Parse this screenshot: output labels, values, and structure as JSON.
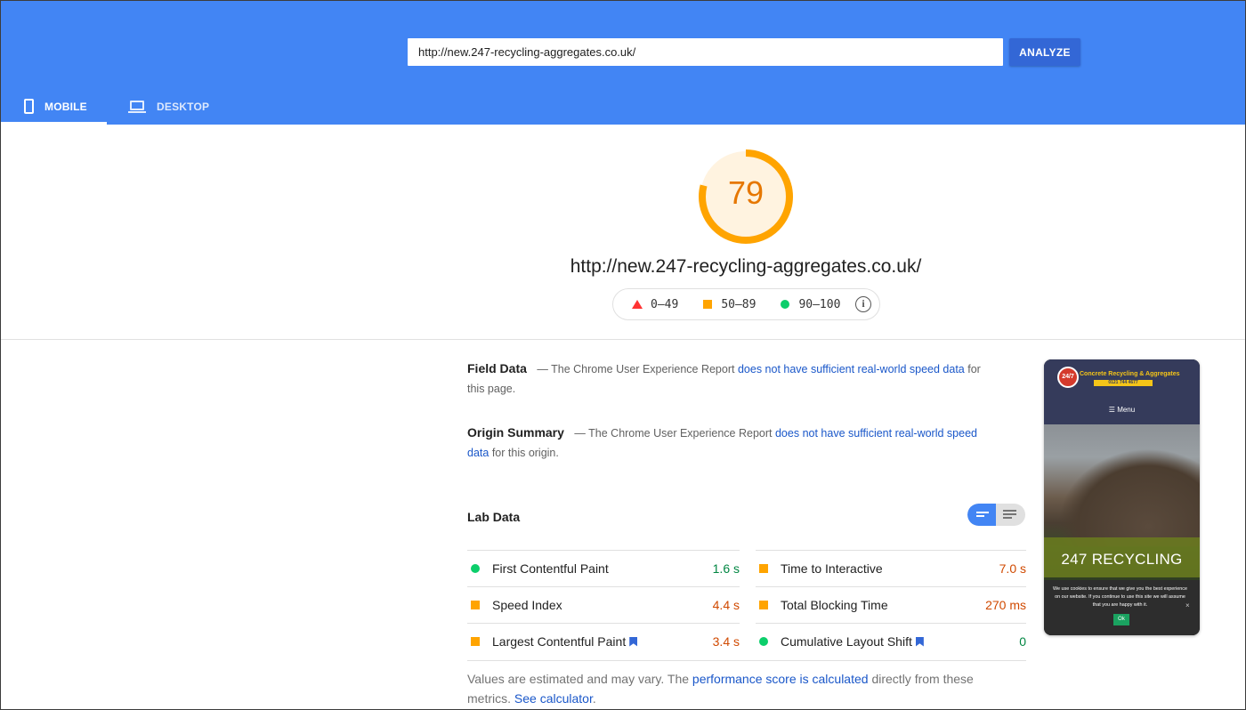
{
  "search": {
    "url_value": "http://new.247-recycling-aggregates.co.uk/",
    "analyze_label": "ANALYZE"
  },
  "tabs": [
    {
      "label": "MOBILE",
      "icon": "phone-icon",
      "active": true
    },
    {
      "label": "DESKTOP",
      "icon": "laptop-icon",
      "active": false
    }
  ],
  "score": {
    "value": "79",
    "fraction": 0.79,
    "color": "#ffa400",
    "page_url": "http://new.247-recycling-aggregates.co.uk/"
  },
  "legend": {
    "fail": "0–49",
    "average": "50–89",
    "pass": "90–100",
    "info_glyph": "i"
  },
  "field_data": {
    "title": "Field Data",
    "prefix": "— The Chrome User Experience Report",
    "link": "does not have sufficient real-world speed data",
    "suffix": "for this page."
  },
  "origin_summary": {
    "title": "Origin Summary",
    "prefix": "— The Chrome User Experience Report",
    "link": "does not have sufficient real-world speed data",
    "suffix": "for this origin."
  },
  "lab_data": {
    "title": "Lab Data",
    "metrics": [
      {
        "name": "First Contentful Paint",
        "value": "1.6 s",
        "rating": "good"
      },
      {
        "name": "Time to Interactive",
        "value": "7.0 s",
        "rating": "avg"
      },
      {
        "name": "Speed Index",
        "value": "4.4 s",
        "rating": "avg"
      },
      {
        "name": "Total Blocking Time",
        "value": "270 ms",
        "rating": "avg"
      },
      {
        "name": "Largest Contentful Paint",
        "value": "3.4 s",
        "rating": "avg"
      },
      {
        "name": "Cumulative Layout Shift",
        "value": "0",
        "rating": "good"
      }
    ]
  },
  "note": {
    "text1": "Values are estimated and may vary. The",
    "link1": "performance score is calculated",
    "text2": "directly from these metrics.",
    "link2": "See calculator",
    "text3": "."
  },
  "thumbnail": {
    "logo_text": "24/7",
    "brand": "Concrete Recycling & Aggregates",
    "phone": "0121 744 4677",
    "menu": "☰ Menu",
    "headline": "247 RECYCLING",
    "cookie_text": "We use cookies to ensure that we give you the best experience on our website. If you continue to use this site we will assume that you are happy with it.",
    "ok_label": "Ok",
    "close_glyph": "×"
  }
}
